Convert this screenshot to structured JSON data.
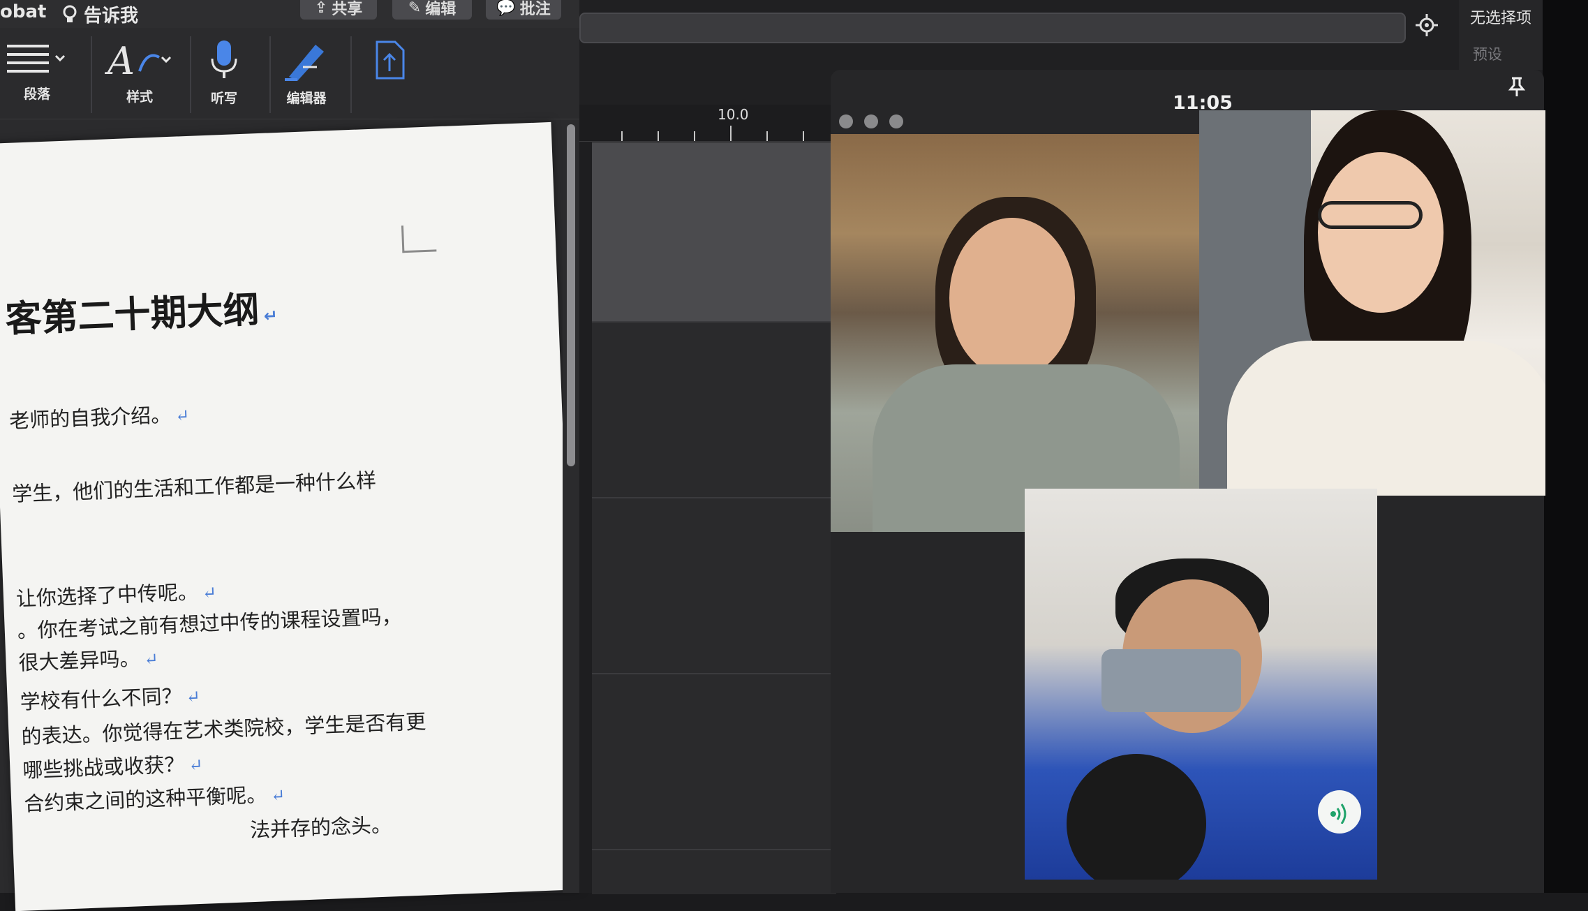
{
  "word": {
    "header": {
      "app_fragment": "obat",
      "tell_me": "告诉我",
      "share_button": "共享",
      "edit_button": "编辑",
      "comment_button": "批注"
    },
    "ribbon": {
      "paragraph": "段落",
      "styles": "样式",
      "dictate": "听写",
      "editor": "编辑器"
    },
    "document": {
      "title": "客第二十期大纲",
      "lines": [
        "老师的自我介绍。",
        "学生，他们的生活和工作都是一种什么样",
        "让你选择了中传呢。",
        "。你在考试之前有想过中传的课程设置吗，",
        "很大差异吗。",
        "学校有什么不同？",
        "的表达。你觉得在艺术类院校，学生是否有更",
        "哪些挑战或收获？",
        "合约束之间的这种平衡呢。",
        "法并存的念头。"
      ]
    }
  },
  "editor": {
    "no_selection": "无选择项",
    "preset": "预设",
    "ruler_label": "10.0"
  },
  "facetime": {
    "time": "11:05",
    "participants": [
      "participant-1",
      "participant-2",
      "participant-3"
    ],
    "icons": [
      "pin-icon",
      "speaker-icon"
    ]
  },
  "colors": {
    "paragraph_mark": "#4a7dd6",
    "document_bg": "#f4f4f2",
    "accent_green": "#1fa36a"
  }
}
